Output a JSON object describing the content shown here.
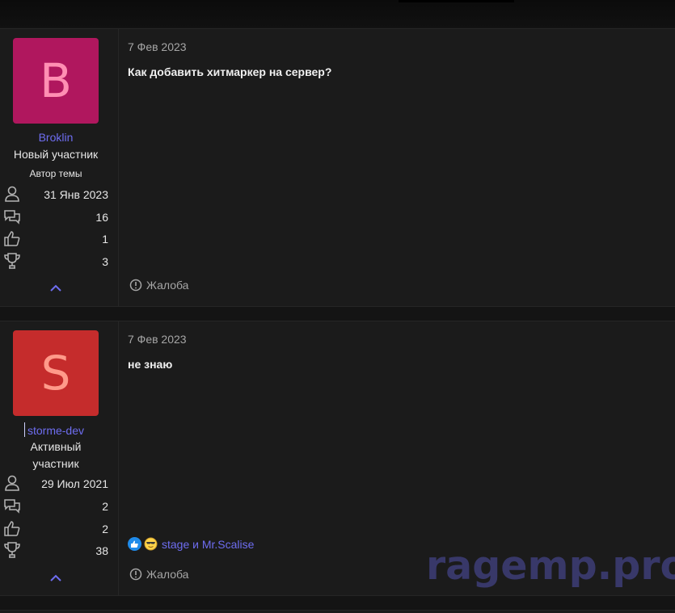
{
  "posts": [
    {
      "avatar_letter": "B",
      "avatar_bg": "#b0175e",
      "avatar_fg": "#ff8fb3",
      "username": "Broklin",
      "title": "Новый участник",
      "banner": "Автор темы",
      "joined": "31 Янв 2023",
      "messages": "16",
      "reactions": "1",
      "points": "3",
      "date": "7 Фев 2023",
      "body": "Как добавить хитмаркер на сервер?",
      "report_label": "Жалоба"
    },
    {
      "avatar_letter": "S",
      "avatar_bg": "#c52c2c",
      "avatar_fg": "#ff9a8a",
      "username": "storme-dev",
      "title_line1": "Активный",
      "title_line2": "участник",
      "joined": "29 Июл 2021",
      "messages": "2",
      "reactions": "2",
      "points": "38",
      "date": "7 Фев 2023",
      "body": "не знаю",
      "reaction_users": "stage и Mr.Scalise",
      "report_label": "Жалоба"
    }
  ],
  "icons": {
    "joined": "user-icon",
    "messages": "messages-icon",
    "reactions": "thumbs-up-icon",
    "points": "trophy-icon",
    "report": "alert-circle-icon",
    "collapse": "chevron-up-icon"
  },
  "watermark": "ragemp.pro",
  "colors": {
    "accent": "#6e6df0",
    "background": "#1b1b1b"
  }
}
